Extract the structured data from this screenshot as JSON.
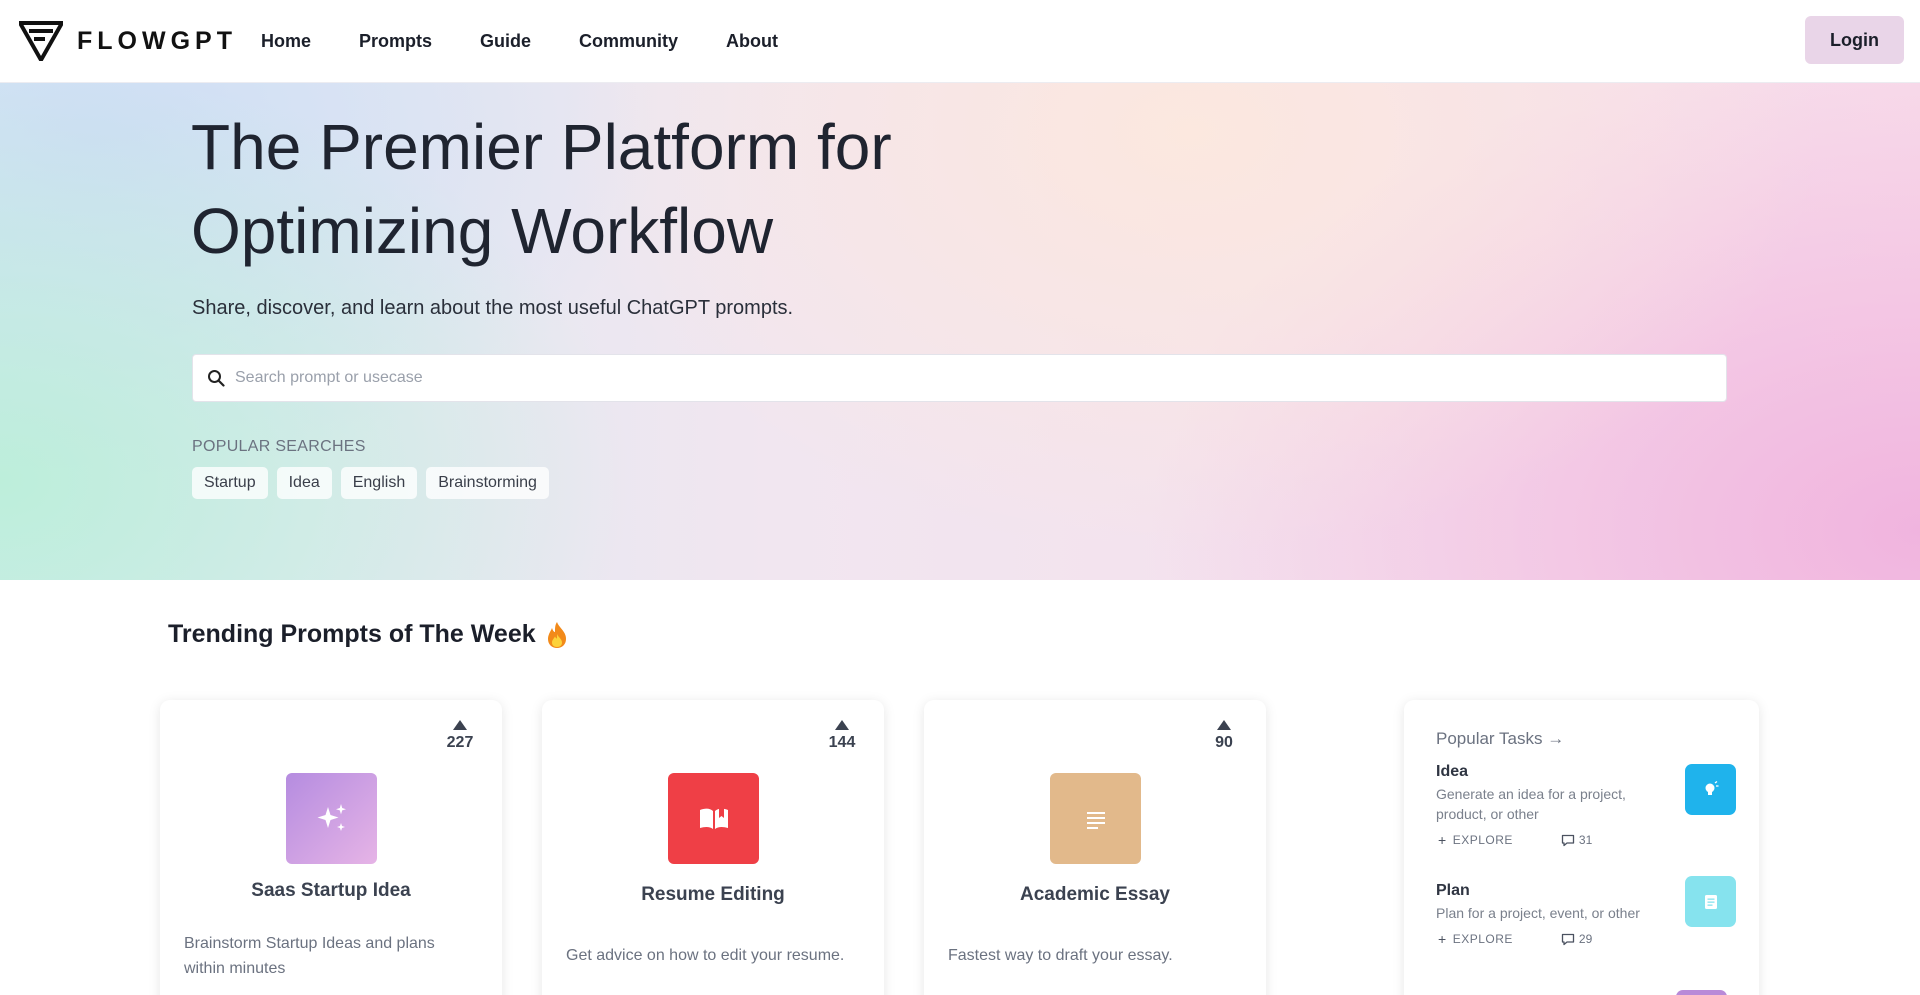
{
  "header": {
    "brand": "FLOWGPT",
    "nav": [
      "Home",
      "Prompts",
      "Guide",
      "Community",
      "About"
    ],
    "login_label": "Login"
  },
  "hero": {
    "title_line1": "The Premier Platform for",
    "title_line2": "Optimizing Workflow",
    "subtitle": "Share, discover, and learn about the most useful ChatGPT prompts.",
    "search_placeholder": "Search prompt or usecase",
    "popular_label": "POPULAR SEARCHES",
    "popular_searches": [
      "Startup",
      "Idea",
      "English",
      "Brainstorming"
    ]
  },
  "trending": {
    "title": "Trending Prompts of The Week",
    "cards": [
      {
        "title": "Saas Startup Idea",
        "description": "Brainstorm Startup Ideas and plans within minutes",
        "votes": "227",
        "icon": "sparkles-icon",
        "color": "#c79be0"
      },
      {
        "title": "Resume Editing",
        "description": "Get advice on how to edit your resume.",
        "votes": "144",
        "icon": "open-book-icon",
        "color": "#ef3f46"
      },
      {
        "title": "Academic Essay",
        "description": "Fastest way to draft your essay.",
        "votes": "90",
        "icon": "document-lines-icon",
        "color": "#e2b98b"
      }
    ]
  },
  "popular_tasks": {
    "heading": "Popular Tasks",
    "arrow": "→",
    "explore_label": "EXPLORE",
    "items": [
      {
        "name": "Idea",
        "description": "Generate an idea for a project, product, or other",
        "comments": "31",
        "icon": "lightbulb-icon",
        "color": "#1fb3ec"
      },
      {
        "name": "Plan",
        "description": "Plan for a project, event, or other",
        "comments": "29",
        "icon": "notepad-icon",
        "color": "#86e3ee"
      }
    ]
  }
}
